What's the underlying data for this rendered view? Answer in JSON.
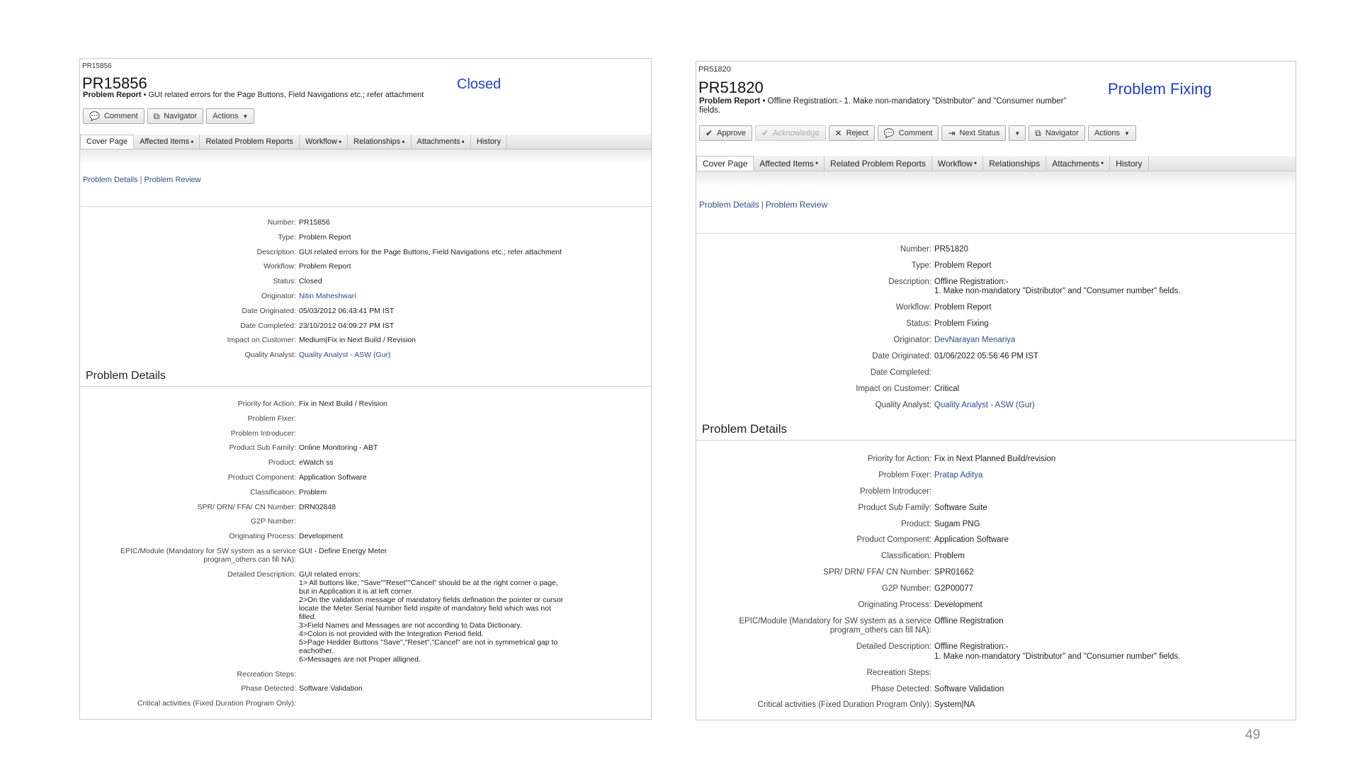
{
  "page_number": "49",
  "left": {
    "small_id": "PR15856",
    "big_id": "PR15856",
    "status": "Closed",
    "subtitle_type": "Problem Report",
    "subtitle_text": " • GUI related errors for the Page Buttons, Field Navigations etc.; refer attachment",
    "toolbar": [
      {
        "label": "Comment",
        "icon": "comment-icon",
        "glyph": "💬"
      },
      {
        "label": "Navigator",
        "icon": "navigator-icon",
        "glyph": "⧉"
      },
      {
        "label": "Actions",
        "icon": "",
        "glyph": "",
        "caret": "▼"
      }
    ],
    "tabs": [
      {
        "label": "Cover Page",
        "dot": ""
      },
      {
        "label": "Affected Items",
        "dot": "●"
      },
      {
        "label": "Related Problem Reports",
        "dot": ""
      },
      {
        "label": "Workflow",
        "dot": "●"
      },
      {
        "label": "Relationships",
        "dot": "●"
      },
      {
        "label": "Attachments",
        "dot": "●"
      },
      {
        "label": "History",
        "dot": ""
      }
    ],
    "links": {
      "details": "Problem Details",
      "separator": "|",
      "review": "Problem Review"
    },
    "section_title": "Problem Details",
    "fields_top": [
      {
        "label": "Number:",
        "value": "PR15856"
      },
      {
        "label": "Type:",
        "value": "Problem Report"
      },
      {
        "label": "Description:",
        "value": "GUI related errors for the Page Buttons, Field Navigations etc.; refer attachment"
      },
      {
        "label": "Workflow:",
        "value": "Problem Report"
      },
      {
        "label": "Status:",
        "value": "Closed"
      },
      {
        "label": "Originator:",
        "value": "Nitin Maheshwari",
        "link": true
      },
      {
        "label": "Date Originated:",
        "value": "05/03/2012 06:43:41 PM IST"
      },
      {
        "label": "Date Completed:",
        "value": "23/10/2012 04:09:27 PM IST"
      },
      {
        "label": "Impact on Customer:",
        "value": "Medium|Fix in Next Build / Revision"
      },
      {
        "label": "Quality Analyst:",
        "value": "Quality Analyst - ASW (Gur)",
        "link": true
      }
    ],
    "fields_details": [
      {
        "label": "Priority for Action:",
        "value": "Fix in Next Build / Revision"
      },
      {
        "label": "Problem Fixer:",
        "value": ""
      },
      {
        "label": "Problem Introducer:",
        "value": ""
      },
      {
        "label": "Product Sub Family:",
        "value": "Online Monitoring - ABT"
      },
      {
        "label": "Product:",
        "value": "eWatch ss"
      },
      {
        "label": "Product Component:",
        "value": "Application Software"
      },
      {
        "label": "Classification:",
        "value": "Problem"
      },
      {
        "label": "SPR/ DRN/ FFA/ CN Number:",
        "value": "DRN02848"
      },
      {
        "label": "G2P Number:",
        "value": ""
      },
      {
        "label": "Originating Process:",
        "value": "Development"
      },
      {
        "label": "EPIC/Module (Mandatory for SW system as a service\nprogram_others can fill NA):",
        "value": "GUI - Define Energy Meter"
      },
      {
        "label": "Detailed Description:",
        "value": "GUI related errors:\n1> All buttons like; \"Save\"\"Reset\"\"Cancel\" should be at the right corner o page,\nbut in Application it is at left corner.\n2>On the validation message of mandatory fields defination the pointer or cursor\nlocate the Meter Serial Number field inspite of mandatory field which was not\nfilled.\n3>Field Names and Messages are not according to Data Dictionary.\n4>Colon is not provided with the Integration Period field.\n5>Page Hedder Buttons \"Save\",\"Reset\",\"Cancel\" are not in symmetrical gap to\neachother.\n6>Messages are not Proper alligned."
      },
      {
        "label": "Recreation Steps:",
        "value": ""
      },
      {
        "label": "Phase Detected:",
        "value": "Software Validation"
      },
      {
        "label": "Critical activities (Fixed Duration Program Only):",
        "value": ""
      }
    ]
  },
  "right": {
    "small_id": "PR51820",
    "big_id": "PR51820",
    "status": "Problem Fixing",
    "subtitle_type": "Problem Report",
    "subtitle_text": " • Offline Registration:- 1. Make non-mandatory \"Distributor\" and \"Consumer number\"\nfields.",
    "toolbar": [
      {
        "label": "Approve",
        "icon": "check-icon",
        "glyph": "✔"
      },
      {
        "label": "Acknowledge",
        "icon": "check-icon",
        "glyph": "✔",
        "disabled": true
      },
      {
        "label": "Reject",
        "icon": "x-icon",
        "glyph": "✕"
      },
      {
        "label": "Comment",
        "icon": "comment-icon",
        "glyph": "💬"
      },
      {
        "label": "Next Status",
        "icon": "next-status-icon",
        "glyph": "⇥"
      },
      {
        "label": "",
        "icon": "",
        "glyph": "",
        "caret": "▼",
        "split": true
      },
      {
        "label": "Navigator",
        "icon": "navigator-icon",
        "glyph": "⧉"
      },
      {
        "label": "Actions",
        "icon": "",
        "glyph": "",
        "caret": "▼"
      }
    ],
    "tabs": [
      {
        "label": "Cover Page",
        "dot": ""
      },
      {
        "label": "Affected Items",
        "dot": "●"
      },
      {
        "label": "Related Problem Reports",
        "dot": ""
      },
      {
        "label": "Workflow",
        "dot": "●"
      },
      {
        "label": "Relationships",
        "dot": ""
      },
      {
        "label": "Attachments",
        "dot": "●"
      },
      {
        "label": "History",
        "dot": ""
      }
    ],
    "links": {
      "details": "Problem Details",
      "separator": "|",
      "review": "Problem Review"
    },
    "section_title": "Problem Details",
    "fields_top": [
      {
        "label": "Number:",
        "value": "PR51820"
      },
      {
        "label": "Type:",
        "value": "Problem Report"
      },
      {
        "label": "Description:",
        "value": "Offline Registration:-\n1. Make non-mandatory \"Distributor\" and \"Consumer number\" fields."
      },
      {
        "label": "Workflow:",
        "value": "Problem Report"
      },
      {
        "label": "Status:",
        "value": "Problem Fixing"
      },
      {
        "label": "Originator:",
        "value": "DevNarayan Menariya",
        "link": true
      },
      {
        "label": "Date Originated:",
        "value": "01/06/2022 05:56:46 PM IST"
      },
      {
        "label": "Date Completed:",
        "value": ""
      },
      {
        "label": "Impact on Customer:",
        "value": "Critical"
      },
      {
        "label": "Quality Analyst:",
        "value": "Quality Analyst - ASW (Gur)",
        "link": true
      }
    ],
    "fields_details": [
      {
        "label": "Priority for Action:",
        "value": "Fix in Next Planned Build/revision"
      },
      {
        "label": "Problem Fixer:",
        "value": "Pratap Aditya",
        "link": true
      },
      {
        "label": "Problem Introducer:",
        "value": ""
      },
      {
        "label": "Product Sub Family:",
        "value": "Software Suite"
      },
      {
        "label": "Product:",
        "value": "Sugam PNG"
      },
      {
        "label": "Product Component:",
        "value": "Application Software"
      },
      {
        "label": "Classification:",
        "value": "Problem"
      },
      {
        "label": "SPR/ DRN/ FFA/ CN Number:",
        "value": "SPR01662"
      },
      {
        "label": "G2P Number:",
        "value": "G2P00077"
      },
      {
        "label": "Originating Process:",
        "value": "Development"
      },
      {
        "label": "EPIC/Module (Mandatory for SW system as a service\nprogram_others can fill NA):",
        "value": "Offline Registration"
      },
      {
        "label": "Detailed Description:",
        "value": "Offline Registration:-\n1. Make non-mandatory \"Distributor\" and \"Consumer number\" fields."
      },
      {
        "label": "Recreation Steps:",
        "value": ""
      },
      {
        "label": "Phase Detected:",
        "value": "Software Validation"
      },
      {
        "label": "Critical activities (Fixed Duration Program Only):",
        "value": "System|NA"
      }
    ]
  }
}
